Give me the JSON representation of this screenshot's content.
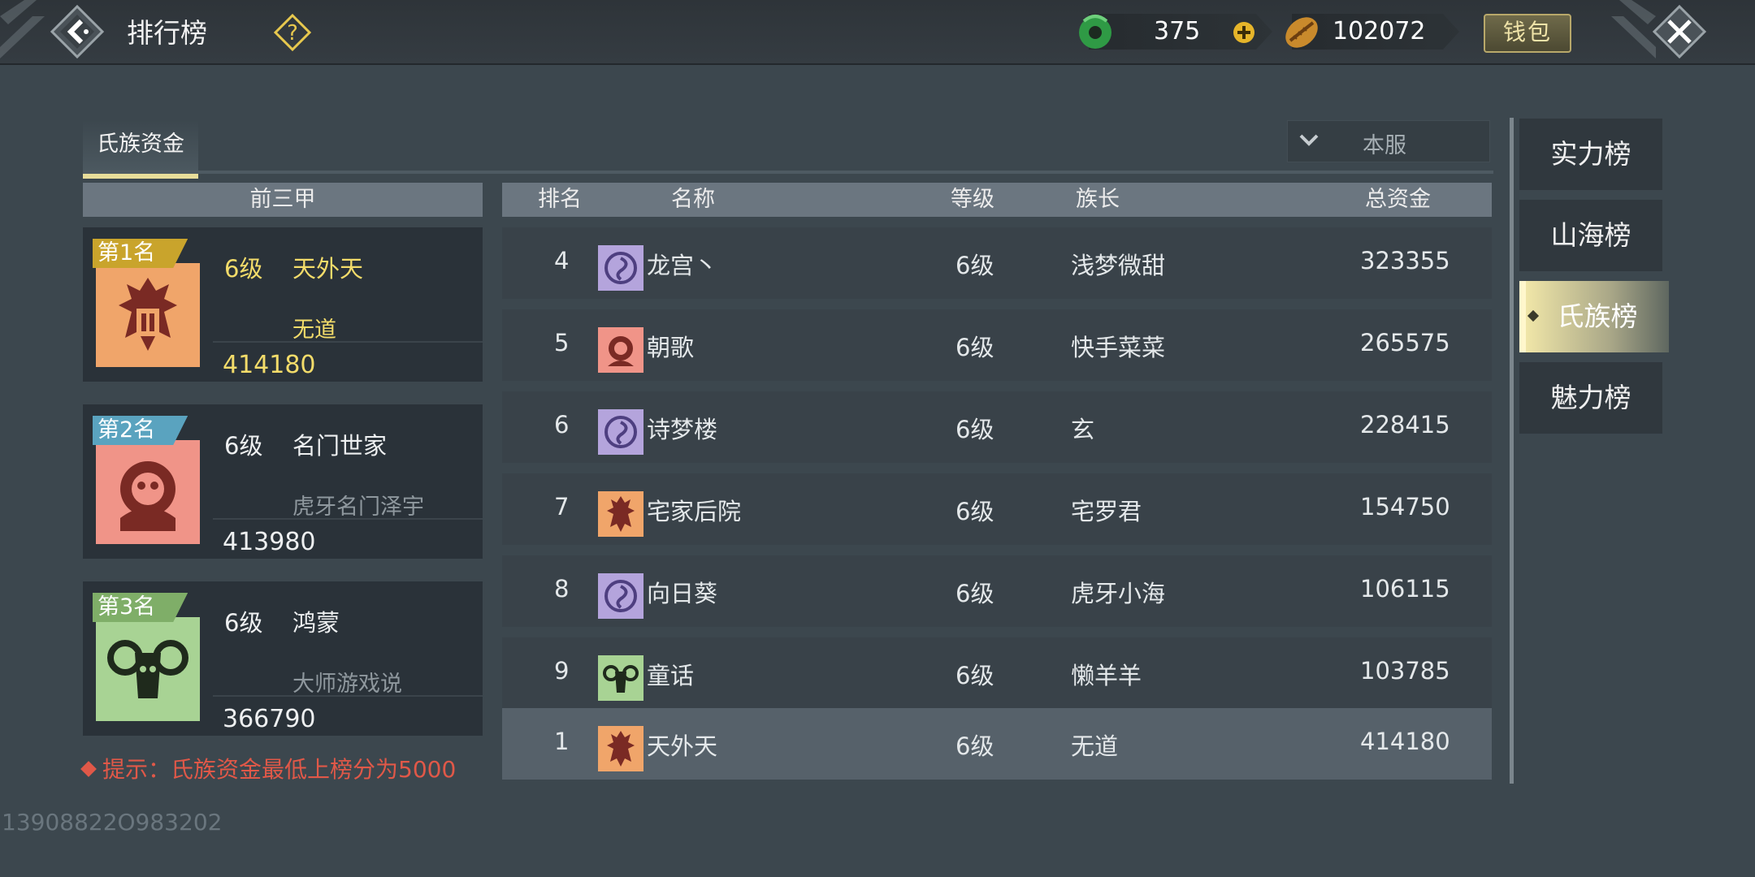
{
  "header": {
    "title": "排行榜",
    "jade_amount": "375",
    "coin_amount": "102072",
    "wallet_label": "钱包"
  },
  "tabs": {
    "active_label": "氏族资金"
  },
  "server_select": {
    "value": "本服"
  },
  "top3": {
    "header": "前三甲",
    "cards": [
      {
        "badge": "第1名",
        "badge_color": "#c9a42c",
        "level": "6级",
        "clan": "天外天",
        "leader": "无道",
        "score": "414180"
      },
      {
        "badge": "第2名",
        "badge_color": "#5aa3bf",
        "level": "6级",
        "clan": "名门世家",
        "leader": "虎牙名门泽宇",
        "score": "413980"
      },
      {
        "badge": "第3名",
        "badge_color": "#7fae68",
        "level": "6级",
        "clan": "鸿蒙",
        "leader": "大师游戏说",
        "score": "366790"
      }
    ]
  },
  "tip": "提示：氏族资金最低上榜分为5000",
  "table": {
    "columns": [
      "排名",
      "名称",
      "等级",
      "族长",
      "总资金"
    ],
    "rows": [
      {
        "rank": "4",
        "name": "龙宫丶",
        "level": "6级",
        "leader": "浅梦微甜",
        "funds": "323355",
        "emblem": "purple-swirl"
      },
      {
        "rank": "5",
        "name": "朝歌",
        "level": "6级",
        "leader": "快手菜菜",
        "funds": "265575",
        "emblem": "pink-lion"
      },
      {
        "rank": "6",
        "name": "诗梦楼",
        "level": "6级",
        "leader": "玄",
        "funds": "228415",
        "emblem": "purple-swirl"
      },
      {
        "rank": "7",
        "name": "宅家后院",
        "level": "6级",
        "leader": "宅罗君",
        "funds": "154750",
        "emblem": "orange-totem"
      },
      {
        "rank": "8",
        "name": "向日葵",
        "level": "6级",
        "leader": "虎牙小海",
        "funds": "106115",
        "emblem": "purple-swirl"
      },
      {
        "rank": "9",
        "name": "童话",
        "level": "6级",
        "leader": "懒羊羊",
        "funds": "103785",
        "emblem": "green-ram"
      }
    ],
    "my_row": {
      "rank": "1",
      "name": "天外天",
      "level": "6级",
      "leader": "无道",
      "funds": "414180",
      "emblem": "orange-totem"
    }
  },
  "nav": [
    "实力榜",
    "山海榜",
    "氏族榜",
    "魅力榜"
  ],
  "nav_active": "氏族榜",
  "uid": "13908822O983202"
}
